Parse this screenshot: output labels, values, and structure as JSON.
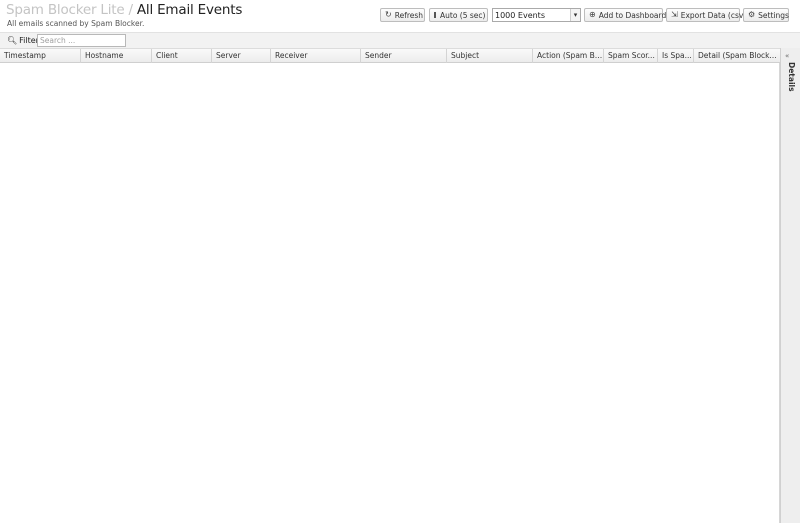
{
  "header": {
    "breadcrumb_parent": "Spam Blocker Lite",
    "separator": "/",
    "title": "All Email Events",
    "subtitle": "All emails scanned by Spam Blocker."
  },
  "toolbar": {
    "refresh": {
      "label": "Refresh",
      "icon": "refresh-icon"
    },
    "auto": {
      "label": "Auto (5 sec)",
      "checked": false
    },
    "limit_select": {
      "value": "1000 Events"
    },
    "add_dashboard": {
      "label": "Add to Dashboard",
      "icon": "plus-icon"
    },
    "export": {
      "label": "Export Data (csv)",
      "icon": "export-icon"
    },
    "settings": {
      "label": "Settings",
      "icon": "gear-icon"
    }
  },
  "filter": {
    "label": "Filter",
    "placeholder": "Search ..."
  },
  "grid": {
    "columns": [
      "Timestamp",
      "Hostname",
      "Client",
      "Server",
      "Receiver",
      "Sender",
      "Subject",
      "Action (Spam Bl...",
      "Spam Scor...",
      "Is Spa...",
      "Detail (Spam Blocker..."
    ],
    "rows": []
  },
  "details_panel": {
    "label": "Details",
    "collapse_glyph": "«"
  }
}
